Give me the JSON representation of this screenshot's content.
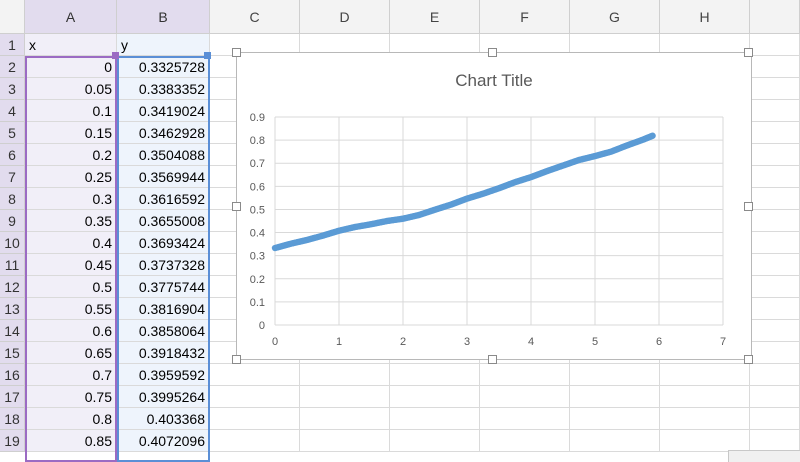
{
  "columns": [
    "A",
    "B",
    "C",
    "D",
    "E",
    "F",
    "G",
    "H"
  ],
  "rows": [
    "1",
    "2",
    "3",
    "4",
    "5",
    "6",
    "7",
    "8",
    "9",
    "10",
    "11",
    "12",
    "13",
    "14",
    "15",
    "16",
    "17",
    "18",
    "19"
  ],
  "header_row": {
    "a": "x",
    "b": "y"
  },
  "table": {
    "x": [
      "0",
      "0.05",
      "0.1",
      "0.15",
      "0.2",
      "0.25",
      "0.3",
      "0.35",
      "0.4",
      "0.45",
      "0.5",
      "0.55",
      "0.6",
      "0.65",
      "0.7",
      "0.75",
      "0.8",
      "0.85"
    ],
    "y": [
      "0.3325728",
      "0.3383352",
      "0.3419024",
      "0.3462928",
      "0.3504088",
      "0.3569944",
      "0.3616592",
      "0.3655008",
      "0.3693424",
      "0.3737328",
      "0.3775744",
      "0.3816904",
      "0.3858064",
      "0.3918432",
      "0.3959592",
      "0.3995264",
      "0.403368",
      "0.4072096"
    ]
  },
  "colors": {
    "series": "#5b9bd5",
    "range_x": "#9b6bc3",
    "range_y": "#5b8fd6"
  },
  "chart_data": {
    "type": "scatter",
    "title": "Chart Title",
    "xlim": [
      0,
      7
    ],
    "ylim": [
      0,
      0.9
    ],
    "x_ticks": [
      "0",
      "1",
      "2",
      "3",
      "4",
      "5",
      "6",
      "7"
    ],
    "y_ticks": [
      "0",
      "0.1",
      "0.2",
      "0.3",
      "0.4",
      "0.5",
      "0.6",
      "0.7",
      "0.8",
      "0.9"
    ],
    "grid": true,
    "series": [
      {
        "x": [
          0,
          0.25,
          0.5,
          0.75,
          1.0,
          1.25,
          1.5,
          1.75,
          2.0,
          2.25,
          2.5,
          2.75,
          3.0,
          3.25,
          3.5,
          3.75,
          4.0,
          4.25,
          4.5,
          4.75,
          5.0,
          5.25,
          5.5,
          5.75,
          5.9
        ],
        "y": [
          0.333,
          0.352,
          0.368,
          0.387,
          0.408,
          0.424,
          0.436,
          0.45,
          0.46,
          0.476,
          0.499,
          0.521,
          0.547,
          0.568,
          0.592,
          0.618,
          0.64,
          0.666,
          0.69,
          0.714,
          0.731,
          0.75,
          0.777,
          0.802,
          0.819
        ]
      }
    ]
  }
}
